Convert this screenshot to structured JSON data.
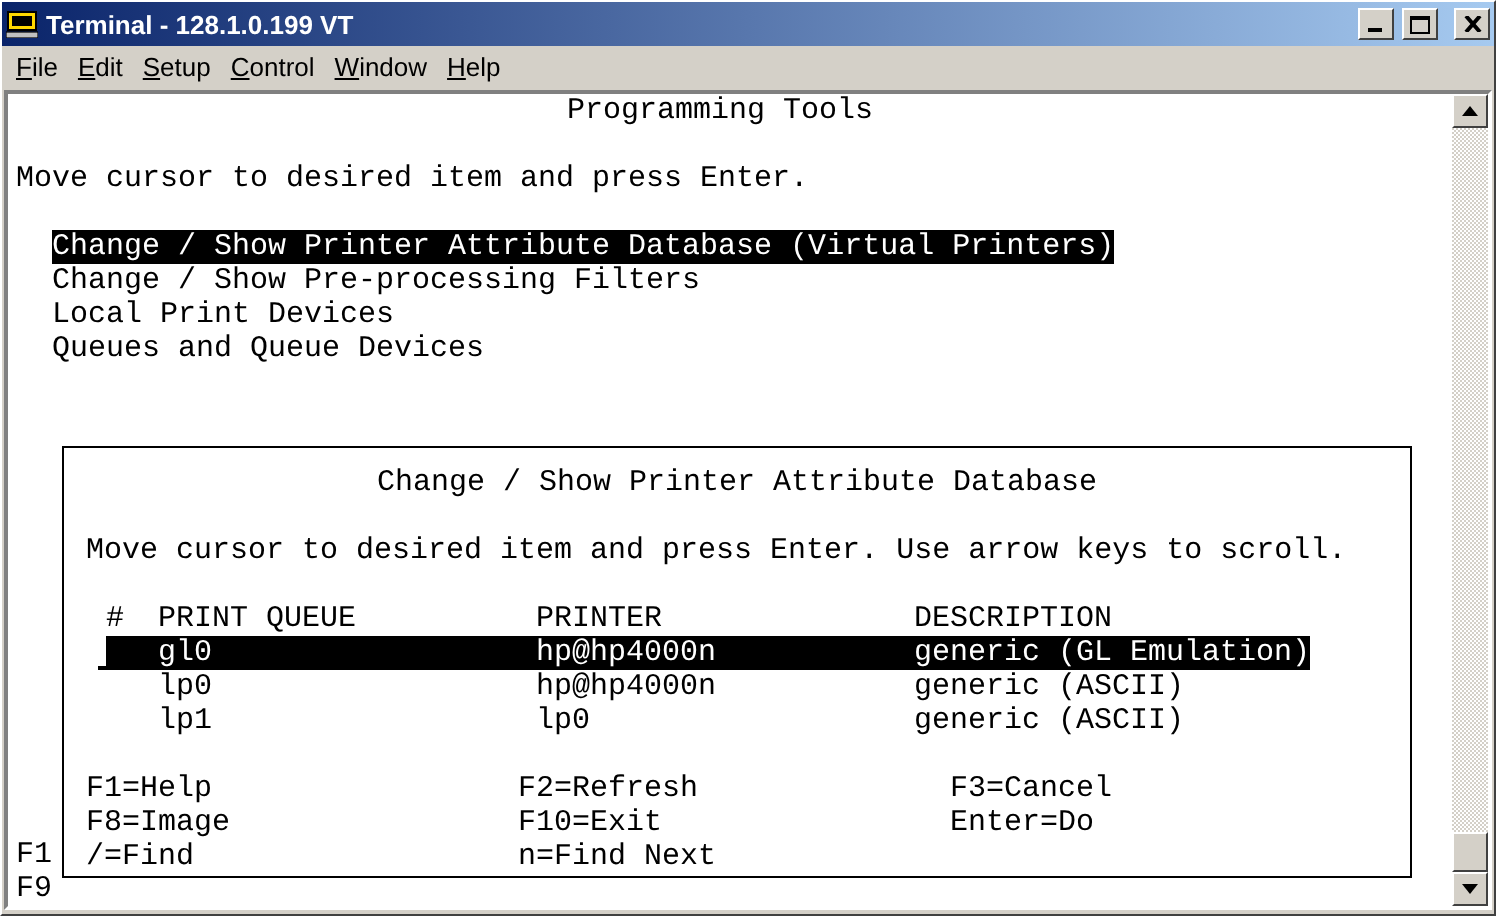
{
  "window": {
    "title": "Terminal - 128.1.0.199 VT"
  },
  "menu": [
    "File",
    "Edit",
    "Setup",
    "Control",
    "Window",
    "Help"
  ],
  "screen": {
    "title": "Programming Tools",
    "instruction": "Move cursor to desired item and press Enter.",
    "items": [
      {
        "label": "Change / Show Printer Attribute Database (Virtual Printers)",
        "selected": true
      },
      {
        "label": "Change / Show Pre-processing Filters",
        "selected": false
      },
      {
        "label": "Local Print Devices",
        "selected": false
      },
      {
        "label": "Queues and Queue Devices",
        "selected": false
      }
    ],
    "bottom_lines": [
      "F1",
      "F9"
    ]
  },
  "dialog": {
    "title": "Change / Show Printer Attribute Database",
    "instruction": "Move cursor to desired item and press Enter. Use arrow keys to scroll.",
    "columns": [
      "#",
      "PRINT QUEUE",
      "PRINTER",
      "DESCRIPTION"
    ],
    "rows": [
      {
        "queue": "gl0",
        "printer": "hp@hp4000n",
        "description": "generic (GL Emulation)",
        "selected": true
      },
      {
        "queue": "lp0",
        "printer": "hp@hp4000n",
        "description": "generic (ASCII)",
        "selected": false
      },
      {
        "queue": "lp1",
        "printer": "lp0",
        "description": "generic (ASCII)",
        "selected": false
      }
    ],
    "keys": [
      "F1=Help",
      "F2=Refresh",
      "F3=Cancel",
      "F8=Image",
      "F10=Exit",
      "Enter=Do",
      "/=Find",
      "n=Find Next"
    ]
  }
}
